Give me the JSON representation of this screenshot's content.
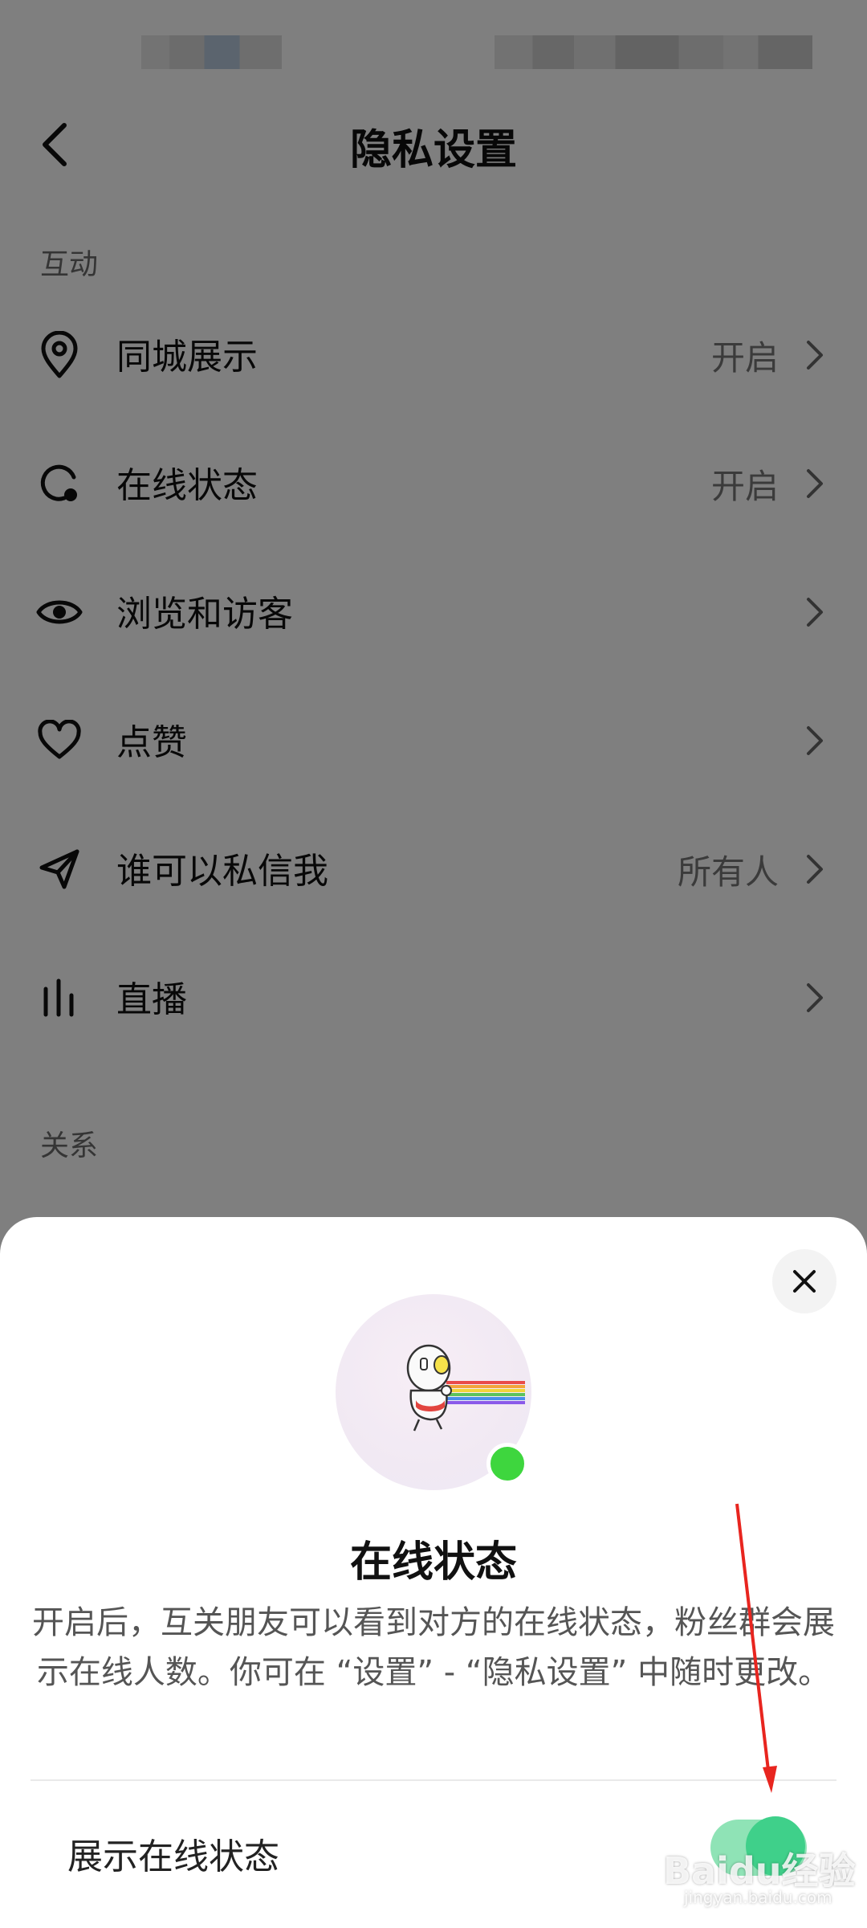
{
  "header": {
    "title": "隐私设置"
  },
  "sections": {
    "interaction_label": "互动",
    "relation_label": "关系"
  },
  "rows": [
    {
      "label": "同城展示",
      "value": "开启",
      "icon": "location-pin-icon"
    },
    {
      "label": "在线状态",
      "value": "开启",
      "icon": "online-status-icon"
    },
    {
      "label": "浏览和访客",
      "value": "",
      "icon": "eye-icon"
    },
    {
      "label": "点赞",
      "value": "",
      "icon": "heart-icon"
    },
    {
      "label": "谁可以私信我",
      "value": "所有人",
      "icon": "send-icon"
    },
    {
      "label": "直播",
      "value": "",
      "icon": "bar-chart-icon"
    }
  ],
  "sheet": {
    "title": "在线状态",
    "description": "开启后，互关朋友可以看到对方的在线状态，粉丝群会展示在线人数。你可在 “设置” - “隐私设置” 中随时更改。",
    "toggle_label": "展示在线状态",
    "toggle_on": true,
    "accent_color": "#3fd08a",
    "online_dot_color": "#3ed63e"
  },
  "watermark": {
    "text": "Baidu经验",
    "sub": "jingyan.baidu.com"
  }
}
